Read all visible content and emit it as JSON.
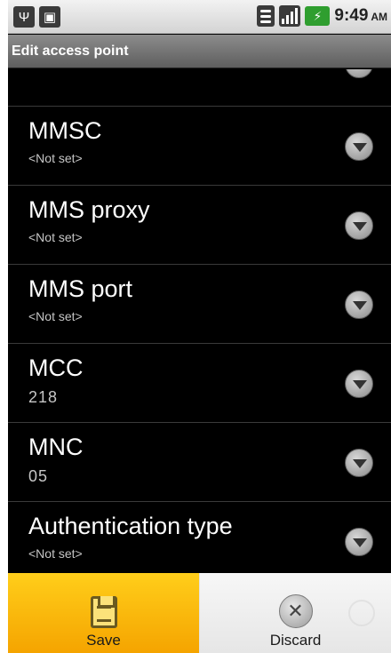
{
  "status_bar": {
    "usb_icon": "usb-icon",
    "notification_icon": "sd-card-icon",
    "time": "9:49",
    "ampm": "AM"
  },
  "title_bar": {
    "title": "Edit access point"
  },
  "settings": [
    {
      "title": "MMSC",
      "summary": "<Not set>"
    },
    {
      "title": "MMS proxy",
      "summary": "<Not set>"
    },
    {
      "title": "MMS port",
      "summary": "<Not set>"
    },
    {
      "title": "MCC",
      "summary": "218"
    },
    {
      "title": "MNC",
      "summary": "05"
    },
    {
      "title": "Authentication type",
      "summary": "<Not set>"
    }
  ],
  "menu": {
    "save_label": "Save",
    "discard_label": "Discard"
  },
  "colors": {
    "save_bg": "#f5a400",
    "list_bg": "#000000",
    "battery": "#2f9e2f"
  }
}
